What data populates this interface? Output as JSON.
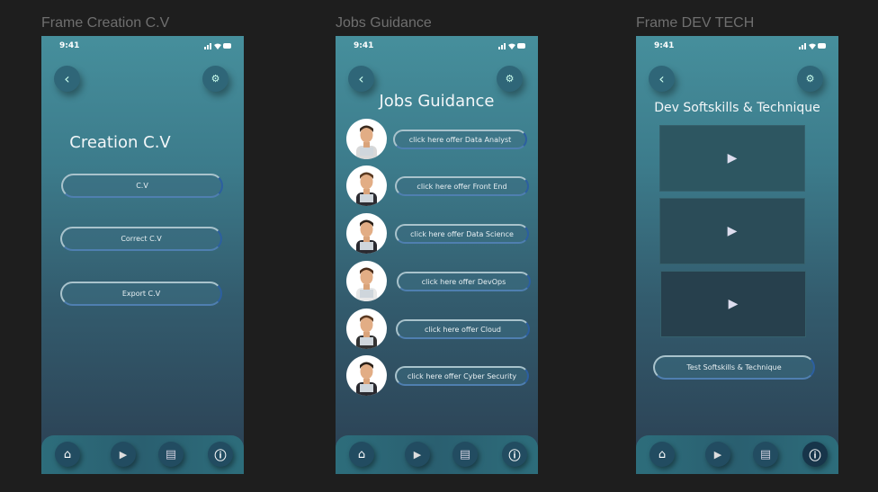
{
  "frames": [
    {
      "label": "Frame Creation C.V",
      "time": "9:41",
      "title": "Creation C.V",
      "buttons": [
        "C.V",
        "Correct C.V",
        "Export C.V"
      ]
    },
    {
      "label": "Jobs Guidance",
      "time": "9:41",
      "title": "Jobs Guidance",
      "offers": [
        "click here offer Data Analyst",
        "click here offer Front End",
        "click here offer Data Science",
        "click here offer DevOps",
        "click here offer Cloud",
        "click here offer Cyber Security"
      ]
    },
    {
      "label": "Frame DEV TECH",
      "time": "9:41",
      "title": "Dev Softskills & Technique",
      "test_button": "Test  Softskills & Technique"
    }
  ],
  "nav_icons": [
    "home-icon",
    "video-library-icon",
    "article-icon",
    "info-icon"
  ],
  "colors": {
    "background": "#1e1e1e",
    "frame_top": "#468f9c",
    "frame_bottom": "#2b3f52"
  }
}
